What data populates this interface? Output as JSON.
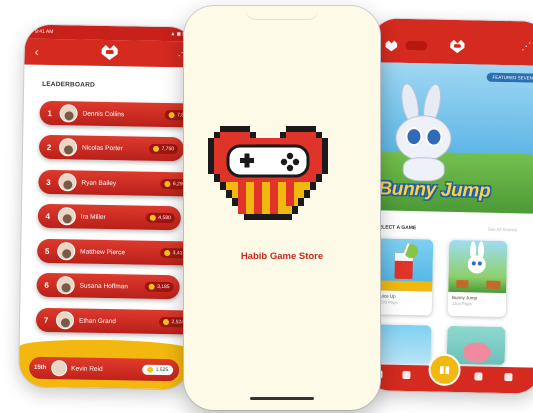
{
  "left_screen": {
    "status_time": "9:41 AM",
    "status_icons": "▲ ◼ ▮",
    "leaderboard_title": "LEADERBOARD",
    "players": [
      {
        "rank": "1",
        "name": "Dennis Collins",
        "score": "7,800"
      },
      {
        "rank": "2",
        "name": "Nicolas Porter",
        "score": "7,750"
      },
      {
        "rank": "3",
        "name": "Ryan Bailey",
        "score": "6,295"
      },
      {
        "rank": "4",
        "name": "Ira Miller",
        "score": "4,580"
      },
      {
        "rank": "5",
        "name": "Matthew Pierce",
        "score": "3,417"
      },
      {
        "rank": "6",
        "name": "Susana Hoffman",
        "score": "3,185"
      },
      {
        "rank": "7",
        "name": "Ethan Grand",
        "score": "2,524"
      }
    ],
    "current_user": {
      "rank": "15th",
      "name": "Kevin Reid",
      "score": "1,525"
    }
  },
  "center_screen": {
    "store_name": "Habib Game Store"
  },
  "right_screen": {
    "featured_label": "FEATURED SEVENTY",
    "featured_game": "Bunny Jump",
    "section_title": "SELECT A GAME",
    "section_link": "See All Games",
    "games": [
      {
        "title": "Juice Up",
        "subtitle": "1520 Plays"
      },
      {
        "title": "Bunny Jump",
        "subtitle": "1204 Plays"
      },
      {
        "title": "",
        "subtitle": ""
      },
      {
        "title": "",
        "subtitle": ""
      }
    ],
    "tab_labels": [
      "Home",
      "Rank",
      "Games",
      "Profile",
      "Store"
    ]
  },
  "colors": {
    "brand_red": "#d42a20",
    "accent_yellow": "#f3b80f",
    "cream": "#fdfbe8"
  }
}
